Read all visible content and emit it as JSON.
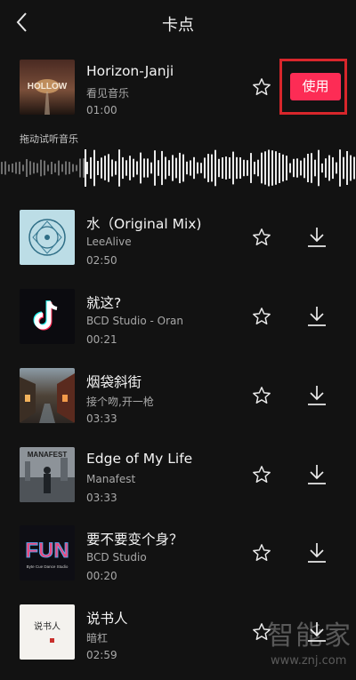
{
  "header": {
    "title": "卡点"
  },
  "section_label": "拖动试听音乐",
  "use_button_label": "使用",
  "songs": [
    {
      "title": "Horizon-Janji",
      "artist": "看见音乐",
      "duration": "01:00",
      "cover_text": "HOLLOW"
    },
    {
      "title": "水（Original Mix)",
      "artist": "LeeAlive",
      "duration": "02:50"
    },
    {
      "title": "就这?",
      "artist": "BCD Studio - Oran",
      "duration": "00:21"
    },
    {
      "title": "烟袋斜街",
      "artist": "接个吻,开一枪",
      "duration": "03:33"
    },
    {
      "title": "Edge of My Life",
      "artist": "Manafest",
      "duration": "03:33",
      "cover_text": "MANAFEST"
    },
    {
      "title": "要不要变个身？",
      "artist": "BCD Studio",
      "duration": "00:20",
      "cover_text": "FUN",
      "cover_subtext": "Byte Cue Dance Studio"
    },
    {
      "title": "说书人",
      "artist": "暗杠",
      "duration": "02:59",
      "cover_text": "说书人"
    }
  ],
  "watermark": {
    "logo": "智能家",
    "url": "www.znj.com"
  },
  "colors": {
    "background": "#121212",
    "accent": "#fd2c55",
    "highlight_frame": "#d7262b"
  }
}
